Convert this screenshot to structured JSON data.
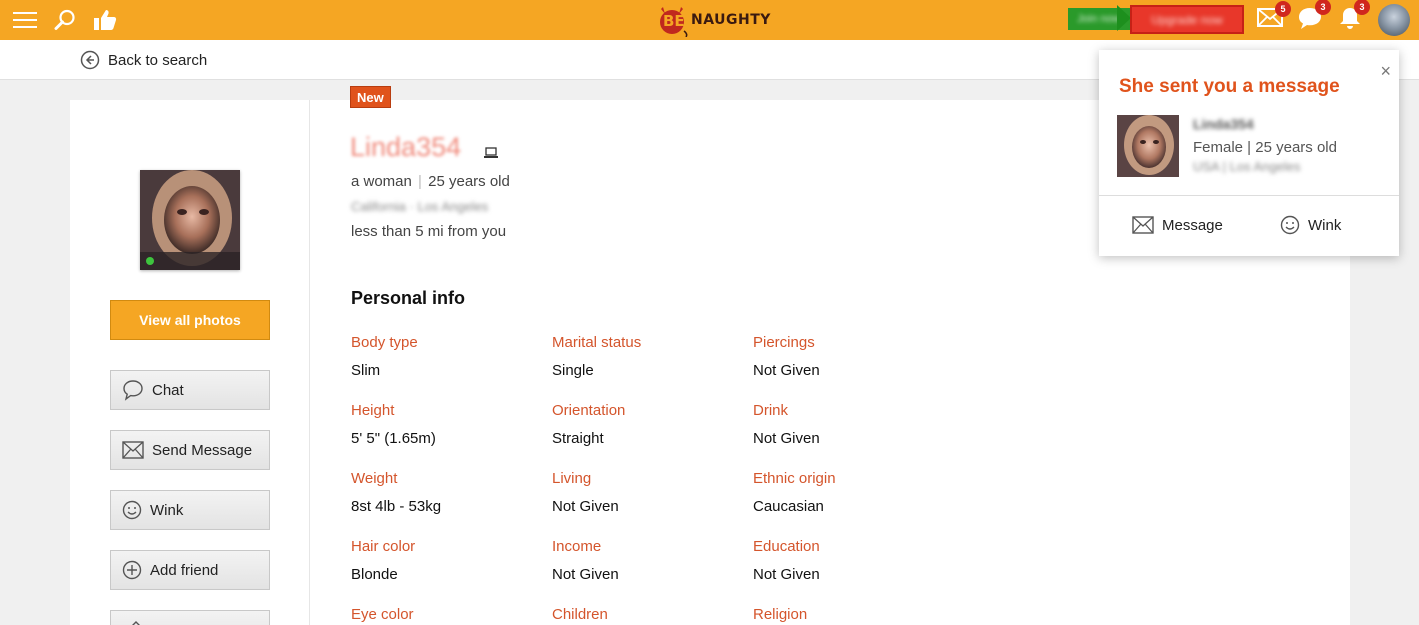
{
  "header": {
    "logo_text": "NAUGHTY",
    "logo_mark": "BE",
    "join_label": "Join now",
    "upgrade_label": "Upgrade now",
    "messages_count": "5",
    "chats_count": "3",
    "notifications_count": "3",
    "brand_color": "#f5a623"
  },
  "nav": {
    "back_label": "Back to search"
  },
  "sidebar": {
    "view_photos_label": "View all photos",
    "buttons": [
      {
        "label": "Chat",
        "icon": "chat-bubble-icon"
      },
      {
        "label": "Send Message",
        "icon": "envelope-icon"
      },
      {
        "label": "Wink",
        "icon": "smiley-icon"
      },
      {
        "label": "Add friend",
        "icon": "plus-circle-icon"
      }
    ]
  },
  "profile": {
    "badge": "New",
    "username": "Linda354",
    "gender_text": "a woman",
    "age_text": "25 years old",
    "location": "California · Los Angeles",
    "distance": "less than 5 mi from you"
  },
  "personal_info": {
    "title": "Personal info",
    "rows": [
      [
        {
          "label": "Body type",
          "value": "Slim"
        },
        {
          "label": "Marital status",
          "value": "Single"
        },
        {
          "label": "Piercings",
          "value": "Not Given"
        }
      ],
      [
        {
          "label": "Height",
          "value": "5' 5\" (1.65m)"
        },
        {
          "label": "Orientation",
          "value": "Straight"
        },
        {
          "label": "Drink",
          "value": "Not Given"
        }
      ],
      [
        {
          "label": "Weight",
          "value": "8st 4lb - 53kg"
        },
        {
          "label": "Living",
          "value": "Not Given"
        },
        {
          "label": "Ethnic origin",
          "value": "Caucasian"
        }
      ],
      [
        {
          "label": "Hair color",
          "value": "Blonde"
        },
        {
          "label": "Income",
          "value": "Not Given"
        },
        {
          "label": "Education",
          "value": "Not Given"
        }
      ],
      [
        {
          "label": "Eye color",
          "value": ""
        },
        {
          "label": "Children",
          "value": ""
        },
        {
          "label": "Religion",
          "value": ""
        }
      ]
    ]
  },
  "popup": {
    "title": "She sent you a message",
    "name": "Linda354",
    "info": "Female | 25 years old",
    "location": "USA | Los Angeles",
    "message_label": "Message",
    "wink_label": "Wink",
    "close_glyph": "×"
  },
  "colors": {
    "accent": "#f5a623",
    "label": "#d4552c",
    "badge": "#d0271e",
    "popup_title": "#e0531c"
  }
}
